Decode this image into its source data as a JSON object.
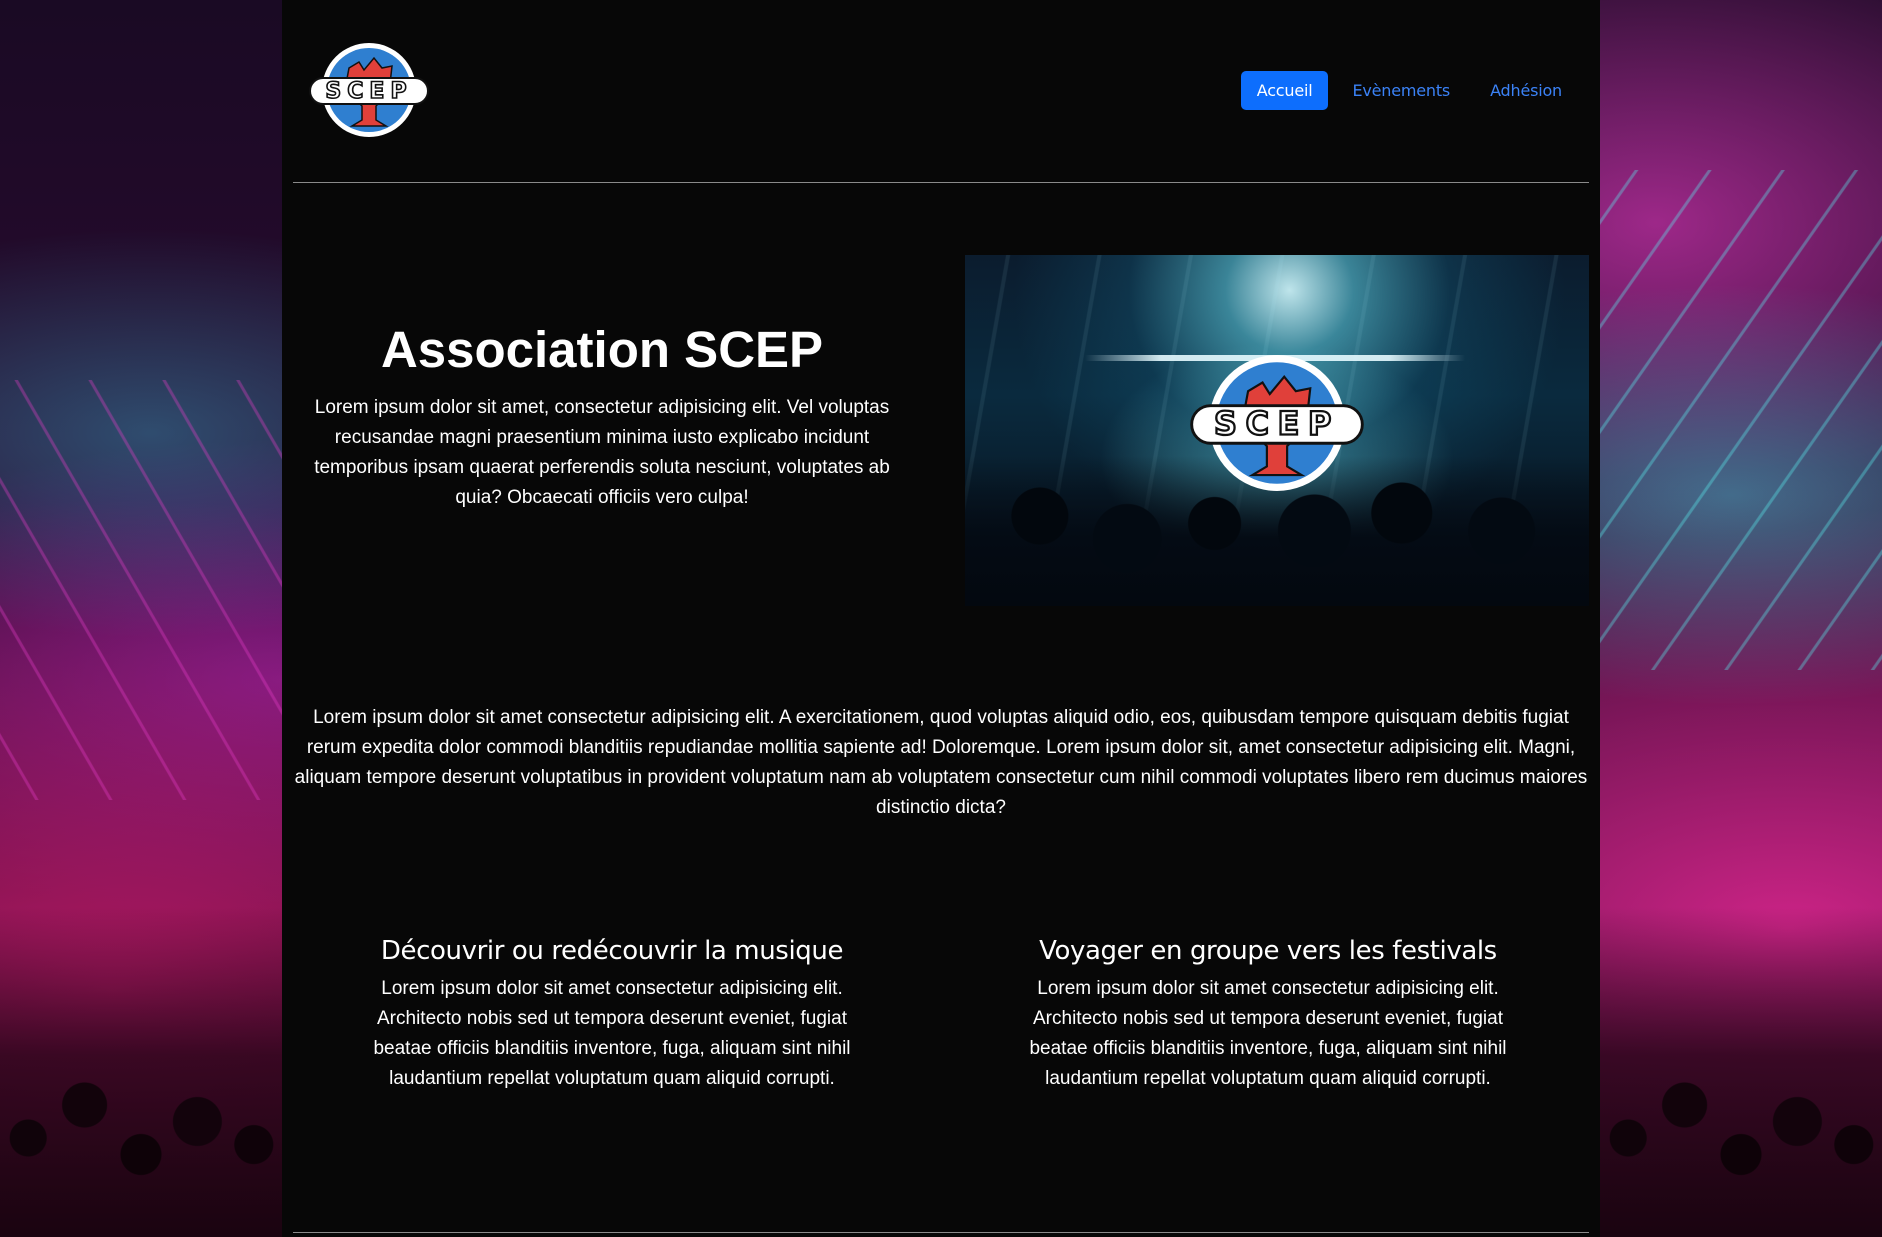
{
  "brand": {
    "logo_text": "SCEP"
  },
  "nav": {
    "items": [
      {
        "label": "Accueil",
        "active": true
      },
      {
        "label": "Evènements",
        "active": false
      },
      {
        "label": "Adhésion",
        "active": false
      }
    ]
  },
  "hero": {
    "title": "Association SCEP",
    "text": "Lorem ipsum dolor sit amet, consectetur adipisicing elit. Vel voluptas recusandae magni praesentium minima iusto explicabo incidunt temporibus ipsam quaerat perferendis soluta nesciunt, voluptates ab quia? Obcaecati officiis vero culpa!"
  },
  "intro": {
    "text": "Lorem ipsum dolor sit amet consectetur adipisicing elit. A exercitationem, quod voluptas aliquid odio, eos, quibusdam tempore quisquam debitis fugiat rerum expedita dolor commodi blanditiis repudiandae mollitia sapiente ad! Doloremque. Lorem ipsum dolor sit, amet consectetur adipisicing elit. Magni, aliquam tempore deserunt voluptatibus in provident voluptatum nam ab voluptatem consectetur cum nihil commodi voluptates libero rem ducimus maiores distinctio dicta?"
  },
  "features": [
    {
      "title": "Découvrir ou redécouvrir la musique",
      "text": "Lorem ipsum dolor sit amet consectetur adipisicing elit. Architecto nobis sed ut tempora deserunt eveniet, fugiat beatae officiis blanditiis inventore, fuga, aliquam sint nihil laudantium repellat voluptatum quam aliquid corrupti."
    },
    {
      "title": "Voyager en groupe vers les festivals",
      "text": "Lorem ipsum dolor sit amet consectetur adipisicing elit. Architecto nobis sed ut tempora deserunt eveniet, fugiat beatae officiis blanditiis inventore, fuga, aliquam sint nihil laudantium repellat voluptatum quam aliquid corrupti."
    }
  ],
  "colors": {
    "accent": "#0d6efd",
    "link": "#3b82f6",
    "page_bg": "#070707",
    "logo_red": "#e0403a",
    "logo_blue": "#2f7fd0"
  }
}
